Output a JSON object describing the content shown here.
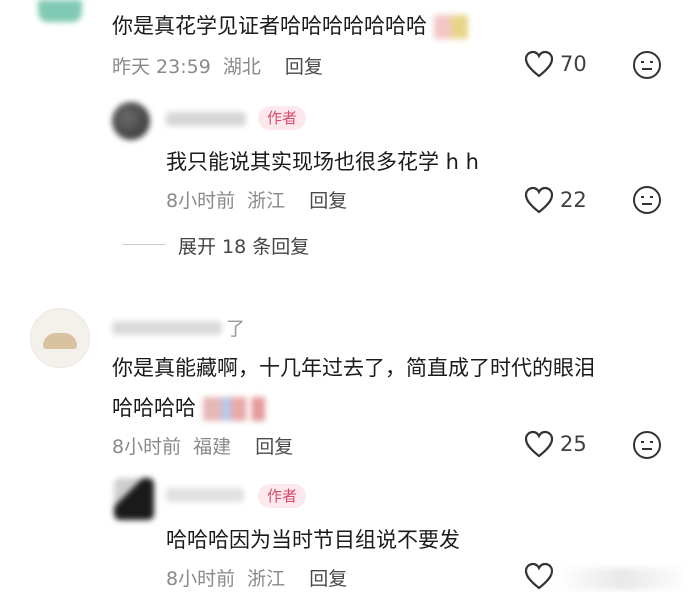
{
  "comments": [
    {
      "text": "你是真花学见证者哈哈哈哈哈哈哈",
      "time": "昨天 23:59",
      "location": "湖北",
      "reply_label": "回复",
      "likes": "70"
    },
    {
      "author_tag": "作者",
      "text": "我只能说其实现场也很多花学 h h",
      "time": "8小时前",
      "location": "浙江",
      "reply_label": "回复",
      "likes": "22"
    },
    {
      "expand_label": "展开 18 条回复"
    },
    {
      "username_visible": "了",
      "text_line1": "你是真能藏啊，十几年过去了，简直成了时代的眼泪",
      "text_line2": "哈哈哈哈",
      "time": "8小时前",
      "location": "福建",
      "reply_label": "回复",
      "likes": "25"
    },
    {
      "author_tag": "作者",
      "text": "哈哈哈因为当时节目组说不要发",
      "time": "8小时前",
      "location": "浙江",
      "reply_label": "回复"
    }
  ],
  "icons": {
    "like": "heart-outline-icon",
    "dislike": "meh-face-icon"
  },
  "colors": {
    "author_tag_text": "#d94b6a",
    "author_tag_bg": "#fde8ee",
    "meta": "#8a8a8a"
  }
}
